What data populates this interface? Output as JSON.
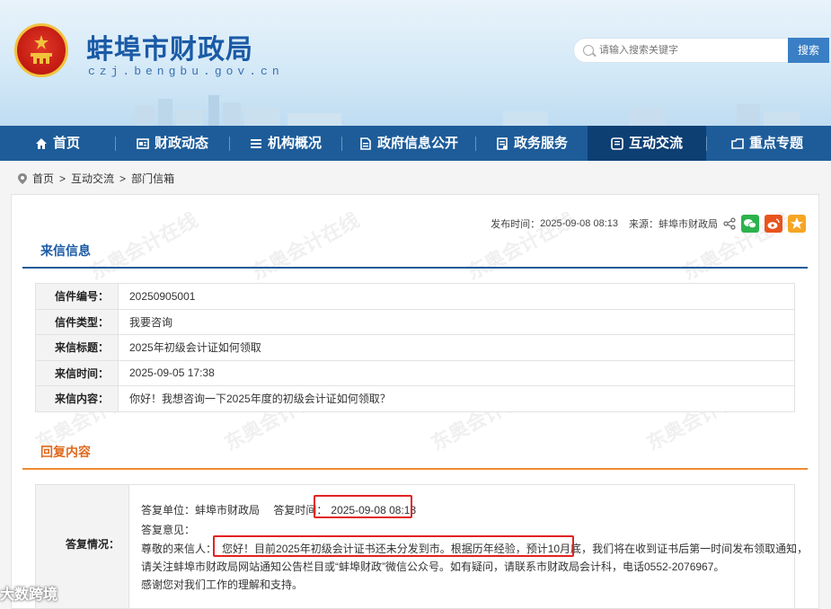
{
  "header": {
    "site_title": "蚌埠市财政局",
    "domain": "czj.bengbu.gov.cn",
    "search_placeholder": "请输入搜索关键字",
    "search_button": "搜索",
    "brand_color": "#1d5c99"
  },
  "nav": {
    "items": [
      {
        "label": "首页",
        "icon": "home-icon"
      },
      {
        "label": "财政动态",
        "icon": "news-icon"
      },
      {
        "label": "机构概况",
        "icon": "list-icon"
      },
      {
        "label": "政府信息公开",
        "icon": "document-icon"
      },
      {
        "label": "政务服务",
        "icon": "service-icon"
      },
      {
        "label": "互动交流",
        "icon": "chat-icon",
        "active": true
      },
      {
        "label": "重点专题",
        "icon": "folder-icon"
      }
    ]
  },
  "breadcrumb": [
    "首页",
    "互动交流",
    "部门信箱"
  ],
  "meta": {
    "publish_time_label": "发布时间：",
    "publish_time": "2025-09-08 08:13",
    "source_label": "来源：",
    "source": "蚌埠市财政局"
  },
  "letter": {
    "section_title": "来信信息",
    "rows": [
      {
        "label": "信件编号：",
        "value": "20250905001"
      },
      {
        "label": "信件类型：",
        "value": "我要咨询"
      },
      {
        "label": "来信标题：",
        "value": "2025年初级会计证如何领取"
      },
      {
        "label": "来信时间：",
        "value": "2025-09-05 17:38"
      },
      {
        "label": "来信内容：",
        "value": "你好！我想咨询一下2025年度的初级会计证如何领取？"
      }
    ]
  },
  "reply": {
    "section_title": "回复内容",
    "label": "答复情况：",
    "unit_label": "答复单位：",
    "unit": "蚌埠市财政局",
    "time_label": "答复时间：",
    "time": "2025-09-08 08:13",
    "opinion_label": "答复意见：",
    "greeting": "尊敬的来信人：",
    "highlight": "您好！目前2025年初级会计证书还未分发到市。根据历年经验，预计10月底，",
    "rest1": "我们将在收到证书后第一时间发布领取通知，",
    "line2": "请关注蚌埠市财政局网站通知公告栏目或“蚌埠财政”微信公众号。如有疑问，请联系市财政局会计科，电话0552-2076967。",
    "line3": "感谢您对我们工作的理解和支持。"
  },
  "watermarks": {
    "text": "东奥会计在线",
    "sub": "www.dongao.com",
    "corner": "大数跨境"
  }
}
